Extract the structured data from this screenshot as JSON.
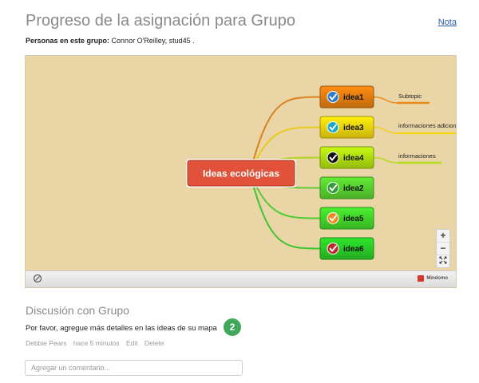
{
  "header": {
    "title": "Progreso de la asignación para Grupo",
    "nota_link": "Nota",
    "members_label": "Personas en este grupo:",
    "members_value": "Connor O'Reilley, stud45 ."
  },
  "mindmap": {
    "central": {
      "label": "Ideas ecológicas",
      "color": "#e0533a"
    },
    "nodes": [
      {
        "label": "idea1",
        "color": "#d9780f",
        "check": "#2d7bd1"
      },
      {
        "label": "idea3",
        "color": "#e6cb0c",
        "check": "#19a8c9"
      },
      {
        "label": "idea4",
        "color": "#a9d40f",
        "check": "#111111"
      },
      {
        "label": "idea2",
        "color": "#54c72c",
        "check": "#2f9b3a"
      },
      {
        "label": "idea5",
        "color": "#3fcc28",
        "check": "#f08a1c"
      },
      {
        "label": "idea6",
        "color": "#29c325",
        "check": "#c0272d"
      }
    ],
    "subtopics": [
      {
        "label": "Subtopic",
        "color": "#e8891a"
      },
      {
        "label": "informaciones adicionales",
        "color": "#f2d414"
      },
      {
        "label": "informaciones",
        "color": "#b5dc1e"
      }
    ],
    "zoom": {
      "in": "+",
      "out": "−"
    },
    "brand": "Mindomo"
  },
  "discussion": {
    "title": "Discusión con Grupo",
    "comment": "Por favor, agregue más detalles en las ideas de su mapa",
    "count": "2",
    "author": "Debbie Pears",
    "time": "hace 5 minutos",
    "edit_label": "Edit",
    "delete_label": "Delete",
    "input_placeholder": "Agregar un comentario..."
  }
}
